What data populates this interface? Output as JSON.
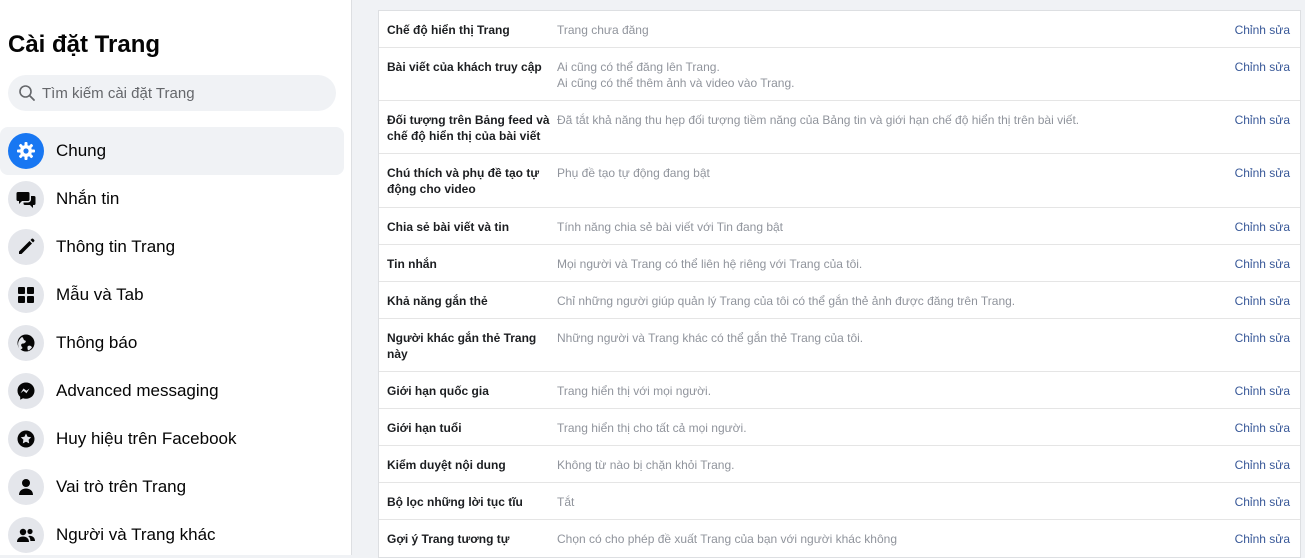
{
  "sidebar": {
    "title": "Cài đặt Trang",
    "search_placeholder": "Tìm kiếm cài đặt Trang",
    "items": [
      {
        "label": "Chung",
        "icon": "gear-icon",
        "active": true
      },
      {
        "label": "Nhắn tin",
        "icon": "chat-bubbles-icon"
      },
      {
        "label": "Thông tin Trang",
        "icon": "pencil-icon"
      },
      {
        "label": "Mẫu và Tab",
        "icon": "grid-icon"
      },
      {
        "label": "Thông báo",
        "icon": "globe-icon"
      },
      {
        "label": "Advanced messaging",
        "icon": "messenger-icon"
      },
      {
        "label": "Huy hiệu trên Facebook",
        "icon": "star-badge-icon"
      },
      {
        "label": "Vai trò trên Trang",
        "icon": "person-icon"
      },
      {
        "label": "Người và Trang khác",
        "icon": "people-icon"
      }
    ]
  },
  "colors": {
    "accent": "#1877f2",
    "link": "#385898",
    "muted": "#90949c"
  },
  "settings": {
    "edit_label": "Chỉnh sửa",
    "rows": [
      {
        "title": "Chế độ hiển thị Trang",
        "desc": [
          "Trang chưa đăng"
        ]
      },
      {
        "title": "Bài viết của khách truy cập",
        "desc": [
          "Ai cũng có thể đăng lên Trang.",
          "Ai cũng có thể thêm ảnh và video vào Trang."
        ]
      },
      {
        "title": "Đối tượng trên Bảng feed và chế độ hiển thị của bài viết",
        "desc": [
          "Đã tắt khả năng thu hẹp đối tượng tiềm năng của Bảng tin và giới hạn chế độ hiển thị trên bài viết."
        ]
      },
      {
        "title": "Chú thích và phụ đề tạo tự động cho video",
        "desc": [
          "Phụ đề tạo tự động đang bật"
        ]
      },
      {
        "title": "Chia sẻ bài viết và tin",
        "desc": [
          "Tính năng chia sẻ bài viết với Tin đang bật"
        ]
      },
      {
        "title": "Tin nhắn",
        "desc": [
          "Mọi người và Trang có thể liên hệ riêng với Trang của tôi."
        ]
      },
      {
        "title": "Khả năng gắn thẻ",
        "desc": [
          "Chỉ những người giúp quản lý Trang của tôi có thể gắn thẻ ảnh được đăng trên Trang."
        ]
      },
      {
        "title": "Người khác gắn thẻ Trang này",
        "desc": [
          "Những người và Trang khác có thể gắn thẻ Trang của tôi."
        ]
      },
      {
        "title": "Giới hạn quốc gia",
        "desc": [
          "Trang hiển thị với mọi người."
        ]
      },
      {
        "title": "Giới hạn tuổi",
        "desc": [
          "Trang hiển thị cho tất cả mọi người."
        ]
      },
      {
        "title": "Kiểm duyệt nội dung",
        "desc": [
          "Không từ nào bị chặn khỏi Trang."
        ]
      },
      {
        "title": "Bộ lọc những lời tục tĩu",
        "desc": [
          "Tắt"
        ]
      },
      {
        "title": "Gợi ý Trang tương tự",
        "desc": [
          "Chọn có cho phép đề xuất Trang của bạn với người khác không"
        ]
      }
    ]
  }
}
